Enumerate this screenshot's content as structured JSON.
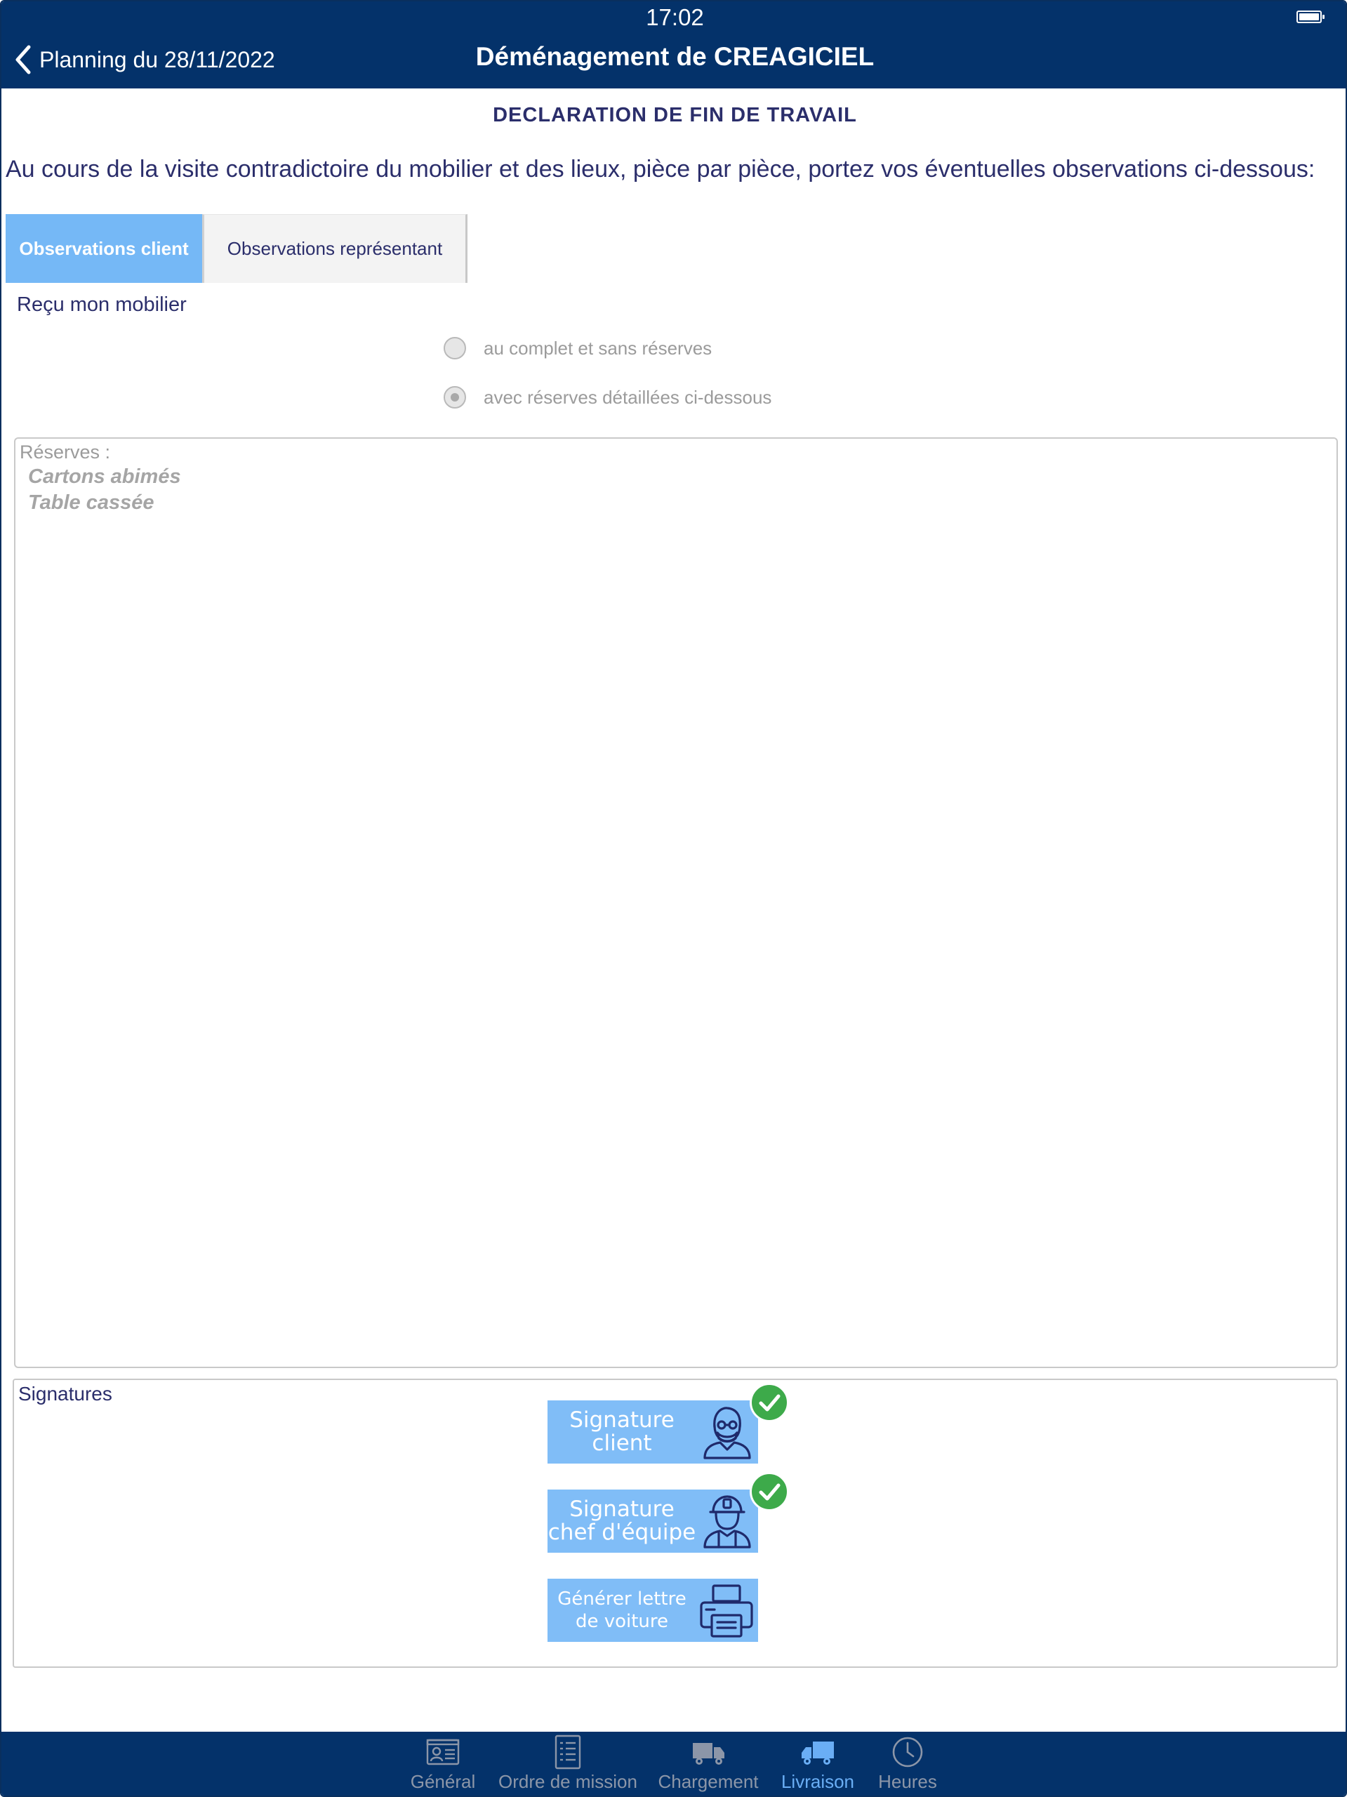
{
  "status_bar": {
    "time": "17:02"
  },
  "header": {
    "back_label": "Planning du 28/11/2022",
    "title": "Déménagement de CREAGICIEL"
  },
  "page": {
    "heading": "DECLARATION DE FIN DE TRAVAIL",
    "instructions": "Au cours de la visite contradictoire du mobilier et des lieux, pièce par pièce, portez vos éventuelles observations ci-dessous:"
  },
  "tabs": [
    {
      "label": "Observations client",
      "active": true
    },
    {
      "label": "Observations représentant",
      "active": false
    }
  ],
  "reception": {
    "label": "Reçu mon mobilier",
    "options": [
      {
        "label": "au complet et sans réserves",
        "selected": false
      },
      {
        "label": "avec réserves détaillées ci-dessous",
        "selected": true
      }
    ]
  },
  "reserves": {
    "label": "Réserves :",
    "value": "Cartons abimés\nTable cassée"
  },
  "signatures": {
    "label": "Signatures",
    "client_button": "Signature\nclient",
    "client_signed": true,
    "chef_button": "Signature\nchef d'équipe",
    "chef_signed": true,
    "letter_button": "Générer lettre\nde voiture"
  },
  "bottom_nav": {
    "items": [
      {
        "label": "Général",
        "icon": "id-card-icon",
        "active": false
      },
      {
        "label": "Ordre de mission",
        "icon": "checklist-icon",
        "active": false
      },
      {
        "label": "Chargement",
        "icon": "truck-icon",
        "active": false
      },
      {
        "label": "Livraison",
        "icon": "delivery-truck-icon",
        "active": true
      },
      {
        "label": "Heures",
        "icon": "clock-icon",
        "active": false
      }
    ]
  },
  "colors": {
    "header_bg": "#04326a",
    "tab_active": "#75b8f6",
    "button_bg": "#80bdf7",
    "check_green": "#3daa4a",
    "text_dark": "#2b2e6b",
    "nav_active": "#6aaef5"
  }
}
